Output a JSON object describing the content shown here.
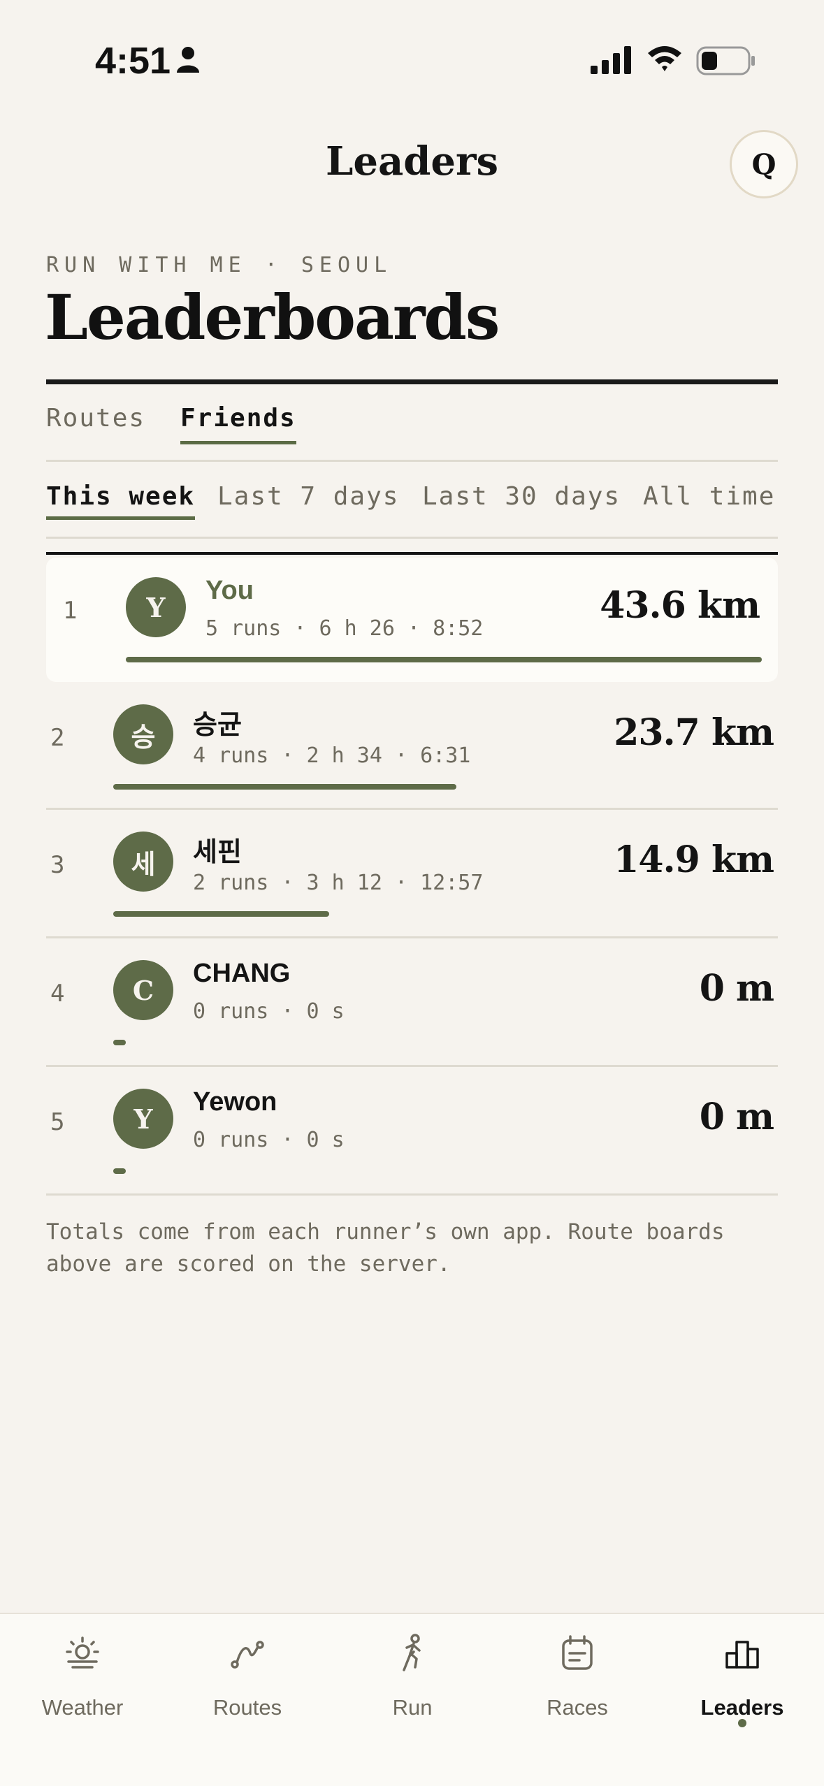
{
  "status_bar": {
    "time": "4:51"
  },
  "header": {
    "title": "Leaders",
    "q_button_label": "Q"
  },
  "eyebrow": "RUN WITH ME · SEOUL",
  "page_title": "Leaderboards",
  "segments": [
    "Routes",
    "Friends"
  ],
  "selected_segment": "Friends",
  "periods": [
    "This week",
    "Last 7 days",
    "Last 30 days",
    "All time"
  ],
  "selected_period": "This week",
  "entries": [
    {
      "rank": "1",
      "initial": "Y",
      "name": "You",
      "meta": "5 runs · 6 h 26 · 8:52",
      "distance": "43.6 km",
      "share": 1.0,
      "is_me": true
    },
    {
      "rank": "2",
      "initial": "승",
      "name": "승균",
      "meta": "4 runs · 2 h 34 · 6:31",
      "distance": "23.7 km",
      "share": 0.54
    },
    {
      "rank": "3",
      "initial": "세",
      "name": "세핀",
      "meta": "2 runs · 3 h 12 · 12:57",
      "distance": "14.9 km",
      "share": 0.34
    },
    {
      "rank": "4",
      "initial": "C",
      "name": "CHANG",
      "meta": "0 runs · 0 s",
      "distance": "0 m",
      "share": 0.0
    },
    {
      "rank": "5",
      "initial": "Y",
      "name": "Yewon",
      "meta": "0 runs · 0 s",
      "distance": "0 m",
      "share": 0.0
    }
  ],
  "footnote": "Totals come from each runner’s own app. Route boards above are scored on the server.",
  "tabs": [
    {
      "label": "Weather",
      "icon": "weather-sun-icon"
    },
    {
      "label": "Routes",
      "icon": "route-path-icon"
    },
    {
      "label": "Run",
      "icon": "runner-icon"
    },
    {
      "label": "Races",
      "icon": "calendar-icon"
    },
    {
      "label": "Leaders",
      "icon": "podium-icon",
      "active": true
    }
  ],
  "colors": {
    "accent": "#5e6b48",
    "background": "#f6f3ee",
    "text": "#141414",
    "muted": "#6e6a5e"
  }
}
